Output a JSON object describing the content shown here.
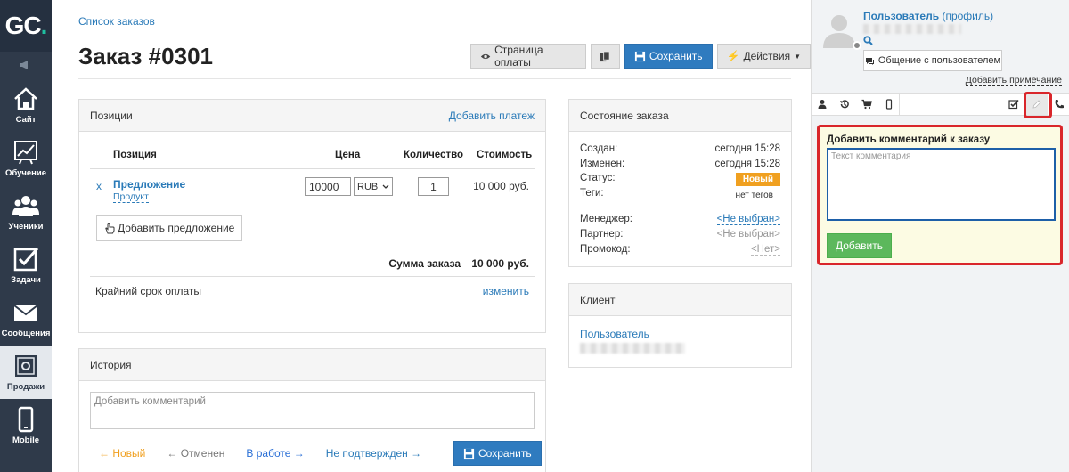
{
  "sidebar": {
    "logo": {
      "letters": "GC",
      "dot": "."
    },
    "items": [
      {
        "label": "Сайт",
        "icon": "home-icon"
      },
      {
        "label": "Обучение",
        "icon": "chart-icon"
      },
      {
        "label": "Ученики",
        "icon": "users-icon"
      },
      {
        "label": "Задачи",
        "icon": "checkbox-icon"
      },
      {
        "label": "Сообщения",
        "icon": "envelope-icon"
      },
      {
        "label": "Продажи",
        "icon": "safe-icon"
      },
      {
        "label": "Mobile",
        "icon": "phone-icon"
      }
    ]
  },
  "header": {
    "breadcrumb": "Список заказов",
    "title": "Заказ #0301",
    "toolbar": {
      "payment_page": "Страница оплаты",
      "save": "Сохранить",
      "actions": "Действия"
    }
  },
  "positions": {
    "title": "Позиции",
    "add_payment": "Добавить платеж",
    "columns": {
      "position": "Позиция",
      "price": "Цена",
      "quantity": "Количество",
      "total": "Стоимость"
    },
    "row": {
      "remove": "x",
      "name": "Предложение",
      "type": "Продукт",
      "price": "10000",
      "currency": "RUB",
      "quantity": "1",
      "total": "10 000 руб."
    },
    "add_offer": "Добавить предложение",
    "sum_label": "Сумма заказа",
    "sum_value": "10 000 руб.",
    "deadline_label": "Крайний срок оплаты",
    "deadline_change": "изменить"
  },
  "history": {
    "title": "История",
    "placeholder": "Добавить комментарий",
    "statuses": {
      "new": "← Новый",
      "cancelled": "← Отменен",
      "in_work": "В работе →",
      "unconfirmed": "Не подтвержден →"
    },
    "save": "Сохранить"
  },
  "order_state": {
    "title": "Состояние заказа",
    "created_label": "Создан:",
    "created_value": "сегодня 15:28",
    "changed_label": "Изменен:",
    "changed_value": "сегодня 15:28",
    "status_label": "Статус:",
    "status_value": "Новый",
    "tags_label": "Теги:",
    "tags_value": "нет тегов",
    "manager_label": "Менеджер:",
    "manager_value": "<Не выбран>",
    "partner_label": "Партнер:",
    "partner_value": "<Не выбран>",
    "promo_label": "Промокод:",
    "promo_value": "<Нет>"
  },
  "client": {
    "title": "Клиент",
    "name": "Пользователь"
  },
  "right_panel": {
    "user_name": "Пользователь",
    "profile": "(профиль)",
    "chat_button": "Общение с пользователем",
    "add_note": "Добавить примечание",
    "comment_title": "Добавить комментарий к заказу",
    "comment_placeholder": "Текст комментария",
    "comment_add": "Добавить"
  },
  "colors": {
    "accent": "#2f7bbf",
    "link": "#2a7ab8",
    "status_new": "#f0a020",
    "highlight": "#d9262b",
    "add_green": "#5cb85c"
  }
}
